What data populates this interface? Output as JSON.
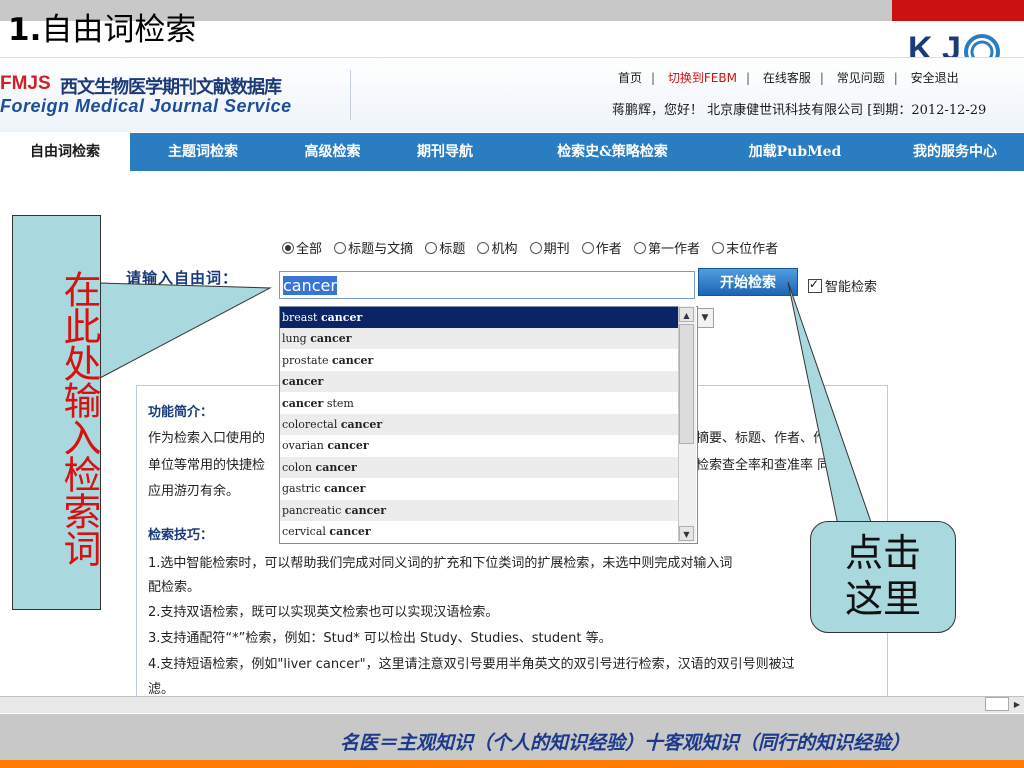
{
  "slide": {
    "title_num": "1.",
    "title_text": "自由词检索",
    "logo_text": "K J"
  },
  "header": {
    "logo_fmjs": "FMJS",
    "logo_cn": "西文生物医学期刊文献数据库",
    "logo_en": "Foreign Medical Journal Service",
    "links": [
      "首页",
      "切换到FEBM",
      "在线客服",
      "常见问题",
      "安全退出"
    ],
    "user_line": "蒋鹏辉，您好！  北京康健世讯科技有限公司 [到期：2012-12-29"
  },
  "nav": {
    "items": [
      "自由词检索",
      "主题词检索",
      "高级检索",
      "期刊导航",
      "检索史&策略检索",
      "加载PubMed",
      "我的服务中心"
    ]
  },
  "search": {
    "options": [
      "全部",
      "标题与文摘",
      "标题",
      "机构",
      "期刊",
      "作者",
      "第一作者",
      "末位作者"
    ],
    "label": "请输入自由词：",
    "value": "cancer",
    "button": "开始检索",
    "smart_label": "智能检索"
  },
  "suggestions": [
    {
      "pre": "breast ",
      "kw": "cancer",
      "post": ""
    },
    {
      "pre": "lung ",
      "kw": "cancer",
      "post": ""
    },
    {
      "pre": "prostate ",
      "kw": "cancer",
      "post": ""
    },
    {
      "pre": "",
      "kw": "cancer",
      "post": ""
    },
    {
      "pre": "",
      "kw": "cancer",
      "post": " stem"
    },
    {
      "pre": "colorectal ",
      "kw": "cancer",
      "post": ""
    },
    {
      "pre": "ovarian ",
      "kw": "cancer",
      "post": ""
    },
    {
      "pre": "colon ",
      "kw": "cancer",
      "post": ""
    },
    {
      "pre": "gastric ",
      "kw": "cancer",
      "post": ""
    },
    {
      "pre": "pancreatic ",
      "kw": "cancer",
      "post": ""
    },
    {
      "pre": "cervical ",
      "kw": "cancer",
      "post": ""
    }
  ],
  "intro": {
    "title": "功能简介：",
    "lines": [
      "作为检索入口使用的",
      "单位等常用的快捷检",
      "应用游刃有余。"
    ],
    "right_lines": [
      "摘要、标题、作者、作者",
      "检索查全率和查准率 同的"
    ]
  },
  "tips": {
    "title": "检索技巧：",
    "lines": [
      "1.选中智能检索时，可以帮助我们完成对同义词的扩充和下位类词的扩展检索，未选中则完成对输入词",
      "配检索。",
      "2.支持双语检索，既可以实现英文检索也可以实现汉语检索。",
      "3.支持通配符“*”检索，例如：Stud* 可以检出 Study、Studies、student 等。",
      "4.支持短语检索，例如\"liver cancer\"，这里请注意双引号要用半角英文的双引号进行检索，汉语的双引号则被过",
      "滤。"
    ]
  },
  "callouts": {
    "left": "在此处输入检索词",
    "right": "点击这里"
  },
  "footer": {
    "text": "名医＝主观知识（个人的知识经验）十客观知识（同行的知识经验）"
  },
  "colors": {
    "nav_bg": "#2a7dc0",
    "callout_bg": "#a9d8de",
    "callout_text": "#d81010",
    "footer_text": "#1d3a8a",
    "accent_orange": "#ff7a00",
    "slide_red": "#cc1111"
  }
}
